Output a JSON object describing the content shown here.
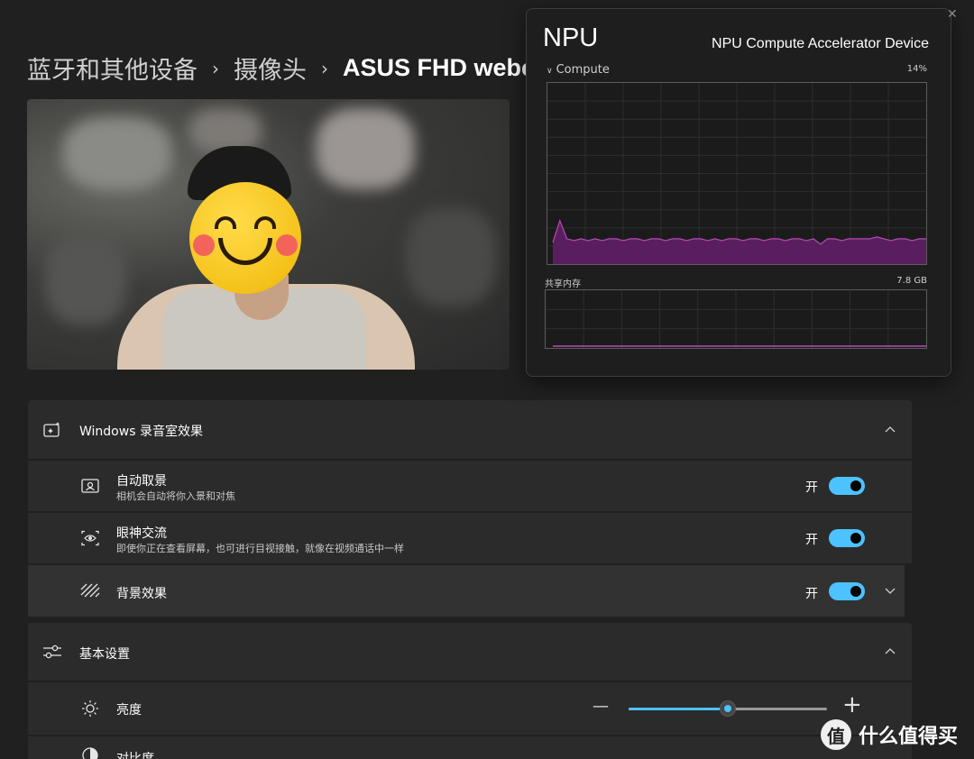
{
  "breadcrumb": [
    "蓝牙和其他设备",
    "摄像头",
    "ASUS FHD webcam"
  ],
  "breadcrumb_separator": "›",
  "studio_effects": {
    "title": "Windows 录音室效果",
    "icon": "sparkle-camera-icon",
    "items": [
      {
        "title": "自动取景",
        "subtitle": "相机会自动将你入景和对焦",
        "state_label": "开",
        "on": true,
        "icon": "frame-icon"
      },
      {
        "title": "眼神交流",
        "subtitle": "即使你正在查看屏幕，也可进行目视接触，就像在视频通话中一样",
        "state_label": "开",
        "on": true,
        "icon": "eye-focus-icon"
      },
      {
        "title": "背景效果",
        "subtitle": "",
        "state_label": "开",
        "on": true,
        "icon": "background-blur-icon"
      }
    ]
  },
  "basic_settings": {
    "title": "基本设置",
    "icon": "sliders-icon",
    "items": [
      {
        "title": "亮度",
        "icon": "sun-icon",
        "value_fraction": 0.5,
        "minus": "—",
        "plus": "+"
      },
      {
        "title": "对比度",
        "icon": "contrast-icon"
      }
    ]
  },
  "npu_panel": {
    "title": "NPU",
    "device": "NPU Compute Accelerator Device",
    "metric": "Compute",
    "metric_pct": "14%",
    "shared_memory_label": "共享内存",
    "shared_memory_value": "7.8 GB",
    "compute_usage": [
      0.12,
      0.24,
      0.14,
      0.13,
      0.14,
      0.13,
      0.14,
      0.13,
      0.14,
      0.14,
      0.13,
      0.14,
      0.14,
      0.13,
      0.14,
      0.14,
      0.13,
      0.14,
      0.14,
      0.13,
      0.14,
      0.14,
      0.13,
      0.14,
      0.13,
      0.14,
      0.14,
      0.13,
      0.14,
      0.14,
      0.13,
      0.14,
      0.14,
      0.13,
      0.14,
      0.14,
      0.13,
      0.14,
      0.11,
      0.14,
      0.14,
      0.13,
      0.14,
      0.14,
      0.14,
      0.14,
      0.15,
      0.14,
      0.13,
      0.14,
      0.14,
      0.13,
      0.14,
      0.14
    ]
  },
  "watermark": {
    "logo": "值",
    "text": "什么值得买"
  },
  "colors": {
    "accent": "#4cc2ff",
    "npu_fill": "#5a1e5e",
    "npu_line": "#b84ab8"
  }
}
